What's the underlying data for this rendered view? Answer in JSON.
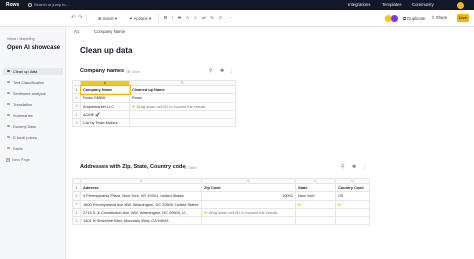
{
  "topbar": {
    "brand": "Rows",
    "search_placeholder": "Search or jump to...",
    "nav": [
      "Integrations",
      "Templates",
      "Community"
    ]
  },
  "toolbar": {
    "insert_label": "Insert",
    "actions_label": "Actions",
    "duplicate_label": "Duplicate",
    "share_label": "Share",
    "live_label": "Live"
  },
  "formula_bar": {
    "cell_ref": "A1",
    "value": "Company Name"
  },
  "sidebar": {
    "breadcrumb": "Views / Marketing",
    "title": "Open AI showcase",
    "items": [
      {
        "label": "Clean up data",
        "active": true
      },
      {
        "label": "Text Classification",
        "active": false
      },
      {
        "label": "Sentiment analysis",
        "active": false
      },
      {
        "label": "Translation",
        "active": false
      },
      {
        "label": "Summaries",
        "active": false
      },
      {
        "label": "Dummy Data",
        "active": false
      },
      {
        "label": "E-book prices",
        "active": false
      },
      {
        "label": "Facts",
        "active": false
      }
    ],
    "new_page": "New Page"
  },
  "main": {
    "title": "Clean up data",
    "table1": {
      "title": "Company names",
      "tag": "Table",
      "col_letters": [
        "A",
        "B"
      ],
      "headers": [
        "Company Name",
        "Cleaned up Name"
      ],
      "rows": [
        {
          "rn": "2",
          "a": "Rows GMBH",
          "b": "Rows"
        },
        {
          "rn": "3",
          "a": "Amplemarket LLC",
          "b": "Drag down cell B2 to expand the results"
        },
        {
          "rn": "4",
          "a": "ACME 🚀",
          "b": ""
        },
        {
          "rn": "5",
          "a": "Car by Tesla Motors",
          "b": ""
        }
      ]
    },
    "table2": {
      "title": "Addresses with Zip, State, Country code",
      "tag": "Table",
      "col_letters": [
        "A",
        "B",
        "C",
        "D"
      ],
      "headers": [
        "Address",
        "Zip Code",
        "State",
        "Country Code"
      ],
      "rows": [
        {
          "rn": "2",
          "a": "4 Pennsylvania Plaza, New York, NY 10001, United States",
          "b": "10001",
          "c": "New York",
          "d": "US"
        },
        {
          "rn": "3",
          "a": "1600 Pennsylvania Ave NW, Washington, DC 20500, United States",
          "b": "",
          "c": "",
          "d": ""
        },
        {
          "rn": "4",
          "a": "2715 S. & Constitution Ave. NW, Washington, DC 20500, U...",
          "b": "Drag down cell B2 to expand the results",
          "c": "",
          "d": ""
        },
        {
          "rn": "5",
          "a": "1401 N Shoreline Blvd, Mountain View, CA 94043",
          "b": "",
          "c": "",
          "d": ""
        }
      ]
    }
  },
  "colors": {
    "topbar": "#121826",
    "accent": "#f5b400",
    "sidebar_bg": "#f6f7f9"
  }
}
